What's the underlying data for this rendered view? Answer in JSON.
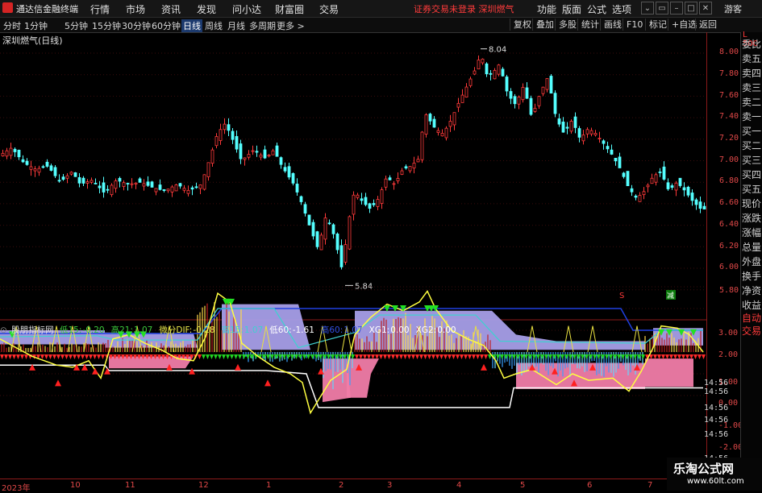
{
  "app": {
    "title": "通达信金融终端",
    "menus": [
      "行情",
      "市场",
      "资讯",
      "发现",
      "问小达",
      "财富圈",
      "交易"
    ],
    "notice": "证券交易未登录",
    "notice_name": "深圳燃气",
    "right_menus": [
      "功能",
      "版面",
      "公式",
      "选项"
    ],
    "guest_label": "游客",
    "win_buttons": [
      "⌄",
      "▭",
      "–",
      "□",
      "✕"
    ]
  },
  "toolbar": {
    "periods": [
      "分时",
      "1分钟",
      "5分钟",
      "15分钟",
      "30分钟",
      "60分钟",
      "日线",
      "周线",
      "月线",
      "多周期",
      "更多 >"
    ],
    "active_period": "日线",
    "buttons": [
      "复权",
      "叠加",
      "多股",
      "统计",
      "画线",
      "F10",
      "标记",
      "+自选",
      "返回"
    ]
  },
  "stock": {
    "name": "深圳燃气(日线)"
  },
  "price_axis": {
    "labels": [
      "8.00",
      "7.80",
      "7.60",
      "7.40",
      "7.20",
      "7.00",
      "6.80",
      "6.60",
      "6.40",
      "6.20",
      "6.00",
      "5.80"
    ],
    "high_marker": "8.04",
    "low_marker": "5.84",
    "corner": "L 500"
  },
  "indicator_axis": {
    "labels": [
      "3.00",
      "2.00",
      "1.00",
      "0.00",
      "-1.00",
      "-2.00"
    ],
    "times": [
      "14:56",
      "14:56",
      "14:56",
      "14:56",
      "14:56",
      "14:56",
      "14:56",
      "14:56"
    ]
  },
  "side_panel": {
    "items": [
      "委比",
      "卖五",
      "卖四",
      "卖三",
      "卖二",
      "卖一",
      "买一",
      "买二",
      "买三",
      "买四",
      "买五",
      "现价",
      "涨跌",
      "涨幅",
      "总量",
      "外盘",
      "换手",
      "净资",
      "收益"
    ],
    "bottom_items": [
      "自动",
      "交易"
    ]
  },
  "indicator": {
    "name": "股朋指标网",
    "fields": [
      {
        "label": "低15:",
        "value": "-0.20",
        "color": "#3cc83c"
      },
      {
        "label": "高21:",
        "value": "1.07",
        "color": "#3cc83c"
      },
      {
        "label": "微分DIF:",
        "value": "-0.28",
        "color": "#e8e84a"
      },
      {
        "label": "高15:",
        "value": "1.07",
        "color": "#40d0d0"
      },
      {
        "label": "低60:",
        "value": "-1.61",
        "color": "#ffffff"
      },
      {
        "label": "高60:",
        "value": "1.07",
        "color": "#3050e0"
      },
      {
        "label": "XG1:",
        "value": "0.00",
        "color": "#ffffff"
      },
      {
        "label": "XG2:",
        "value": "0.00",
        "color": "#ffffff"
      }
    ]
  },
  "dates": [
    "2023年",
    "10",
    "11",
    "12",
    "1",
    "2",
    "3",
    "4",
    "5",
    "6",
    "7"
  ],
  "markers": {
    "s_label": "S",
    "b_label": "减"
  },
  "watermark": {
    "line1": "乐淘公式网",
    "line2": "www.60lt.com"
  },
  "colors": {
    "up": "#ff3a3a",
    "down": "#54ffff",
    "axis": "#8b1a1a",
    "bg": "#000000"
  }
}
